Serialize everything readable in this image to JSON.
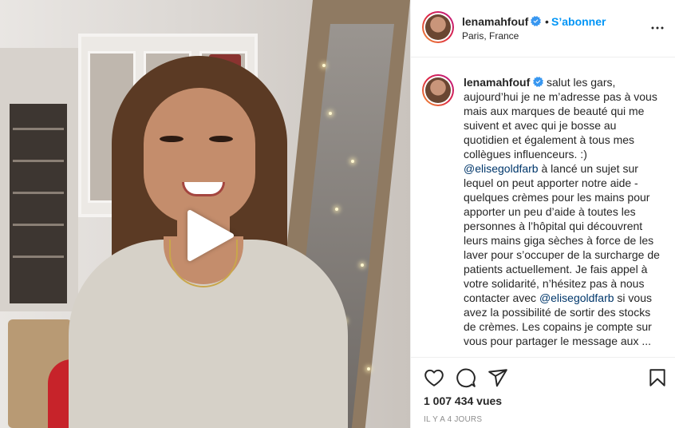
{
  "post": {
    "author": {
      "username": "lenamahfouf",
      "verified_icon": "verified-badge-icon",
      "location": "Paris, France"
    },
    "follow": {
      "separator": "•",
      "label": "S’abonner"
    },
    "caption": {
      "intro": " salut les gars, aujourd’hui je ne m’adresse pas à vous mais aux marques de beauté qui me suivent et avec qui je bosse au quotidien et également à tous mes collègues influenceurs. :)",
      "mention_1": "@elisegoldfarb",
      "part_2": " à lancé un sujet sur lequel on peut apporter notre aide - quelques crèmes pour les mains pour apporter un peu d’aide à toutes les personnes à l’hôpital qui découvrent leurs mains giga sèches à force de les laver pour s’occuper de la surcharge de patients actuellement. Je fais appel à votre solidarité, n’hésitez pas à nous contacter avec ",
      "mention_2": "@elisegoldfarb",
      "part_3": " si vous avez la possibilité de sortir des stocks de crèmes. Les copains je compte sur vous pour partager le message aux ..."
    },
    "views": "1 007 434 vues",
    "timestamp": "IL Y A 4 JOURS"
  },
  "icons": {
    "play": "play-icon",
    "more": "more-options-icon",
    "like": "heart-icon",
    "comment": "comment-icon",
    "share": "share-icon",
    "save": "bookmark-icon"
  },
  "colors": {
    "link_blue": "#0095f6",
    "mention": "#00376b",
    "text": "#262626",
    "muted": "#8e8e8e"
  }
}
